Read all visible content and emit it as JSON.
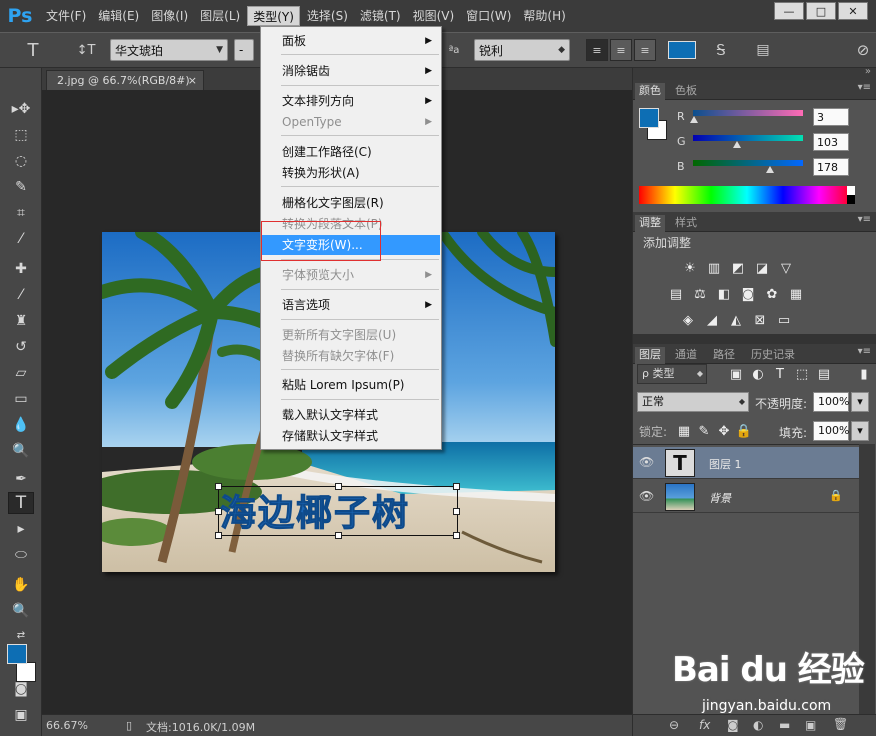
{
  "app": {
    "logo": "Ps",
    "menus": [
      "文件(F)",
      "编辑(E)",
      "图像(I)",
      "图层(L)",
      "类型(Y)",
      "选择(S)",
      "滤镜(T)",
      "视图(V)",
      "窗口(W)",
      "帮助(H)"
    ],
    "active_menu": "类型(Y)",
    "window_controls": [
      "—",
      "□",
      "✕"
    ]
  },
  "options": {
    "tool_glyph": "T",
    "orient_glyph": "↕T",
    "font_family": "华文琥珀",
    "font_style": "-",
    "aa_glyph": "ªa",
    "aa_mode": "锐利",
    "color": "#0d6eb4"
  },
  "document": {
    "tab": "2.jpg @ 66.7%(RGB/8#)",
    "tab_close": "×",
    "art_text": "海边椰子树",
    "zoom": "66.67%",
    "info": "文档:1016.0K/1.09M"
  },
  "type_menu": {
    "items": [
      {
        "label": "面板",
        "sub": true,
        "disabled": false
      },
      {
        "label": "消除锯齿",
        "sub": true,
        "disabled": false
      },
      {
        "label": "文本排列方向",
        "sub": true,
        "disabled": false
      },
      {
        "label": "OpenType",
        "sub": true,
        "disabled": true
      },
      {
        "label": "创建工作路径(C)",
        "sub": false,
        "disabled": false
      },
      {
        "label": "转换为形状(A)",
        "sub": false,
        "disabled": false
      },
      {
        "label": "栅格化文字图层(R)",
        "sub": false,
        "disabled": false
      },
      {
        "label": "转换为段落文本(P)",
        "sub": false,
        "disabled": true
      },
      {
        "label": "文字变形(W)...",
        "sub": false,
        "disabled": false,
        "highlighted": true
      },
      {
        "label": "字体预览大小",
        "sub": true,
        "disabled": true
      },
      {
        "label": "语言选项",
        "sub": true,
        "disabled": false
      },
      {
        "label": "更新所有文字图层(U)",
        "sub": false,
        "disabled": true
      },
      {
        "label": "替换所有缺欠字体(F)",
        "sub": false,
        "disabled": true
      },
      {
        "label": "粘贴 Lorem Ipsum(P)",
        "sub": false,
        "disabled": false
      },
      {
        "label": "载入默认文字样式",
        "sub": false,
        "disabled": false
      },
      {
        "label": "存储默认文字样式",
        "sub": false,
        "disabled": false
      }
    ],
    "submenu_arrow": "▶"
  },
  "color_panel": {
    "tabs": [
      "颜色",
      "色板"
    ],
    "fg": "#0d6eb4",
    "channels": [
      {
        "label": "R",
        "value": "3",
        "fraction": 0.012
      },
      {
        "label": "G",
        "value": "103",
        "fraction": 0.404
      },
      {
        "label": "B",
        "value": "178",
        "fraction": 0.698
      }
    ]
  },
  "adjust_panel": {
    "tabs": [
      "调整",
      "样式"
    ],
    "title": "添加调整"
  },
  "layers_panel": {
    "tabs": [
      "图层",
      "通道",
      "路径",
      "历史记录"
    ],
    "filter_label": "ρ 类型",
    "blend_mode": "正常",
    "opacity_label": "不透明度:",
    "opacity": "100%",
    "lock_label": "锁定:",
    "fill_label": "填充:",
    "fill": "100%",
    "layers": [
      {
        "name": "图层 1",
        "type": "text",
        "selected": true
      },
      {
        "name": "背景",
        "type": "image",
        "locked": true
      }
    ],
    "footer_icons": [
      "⊖",
      "fx",
      "◙",
      "◐",
      "▬",
      "▣",
      "🗑"
    ]
  },
  "watermark": {
    "logo": "Bai du 经验",
    "url": "jingyan.baidu.com"
  }
}
